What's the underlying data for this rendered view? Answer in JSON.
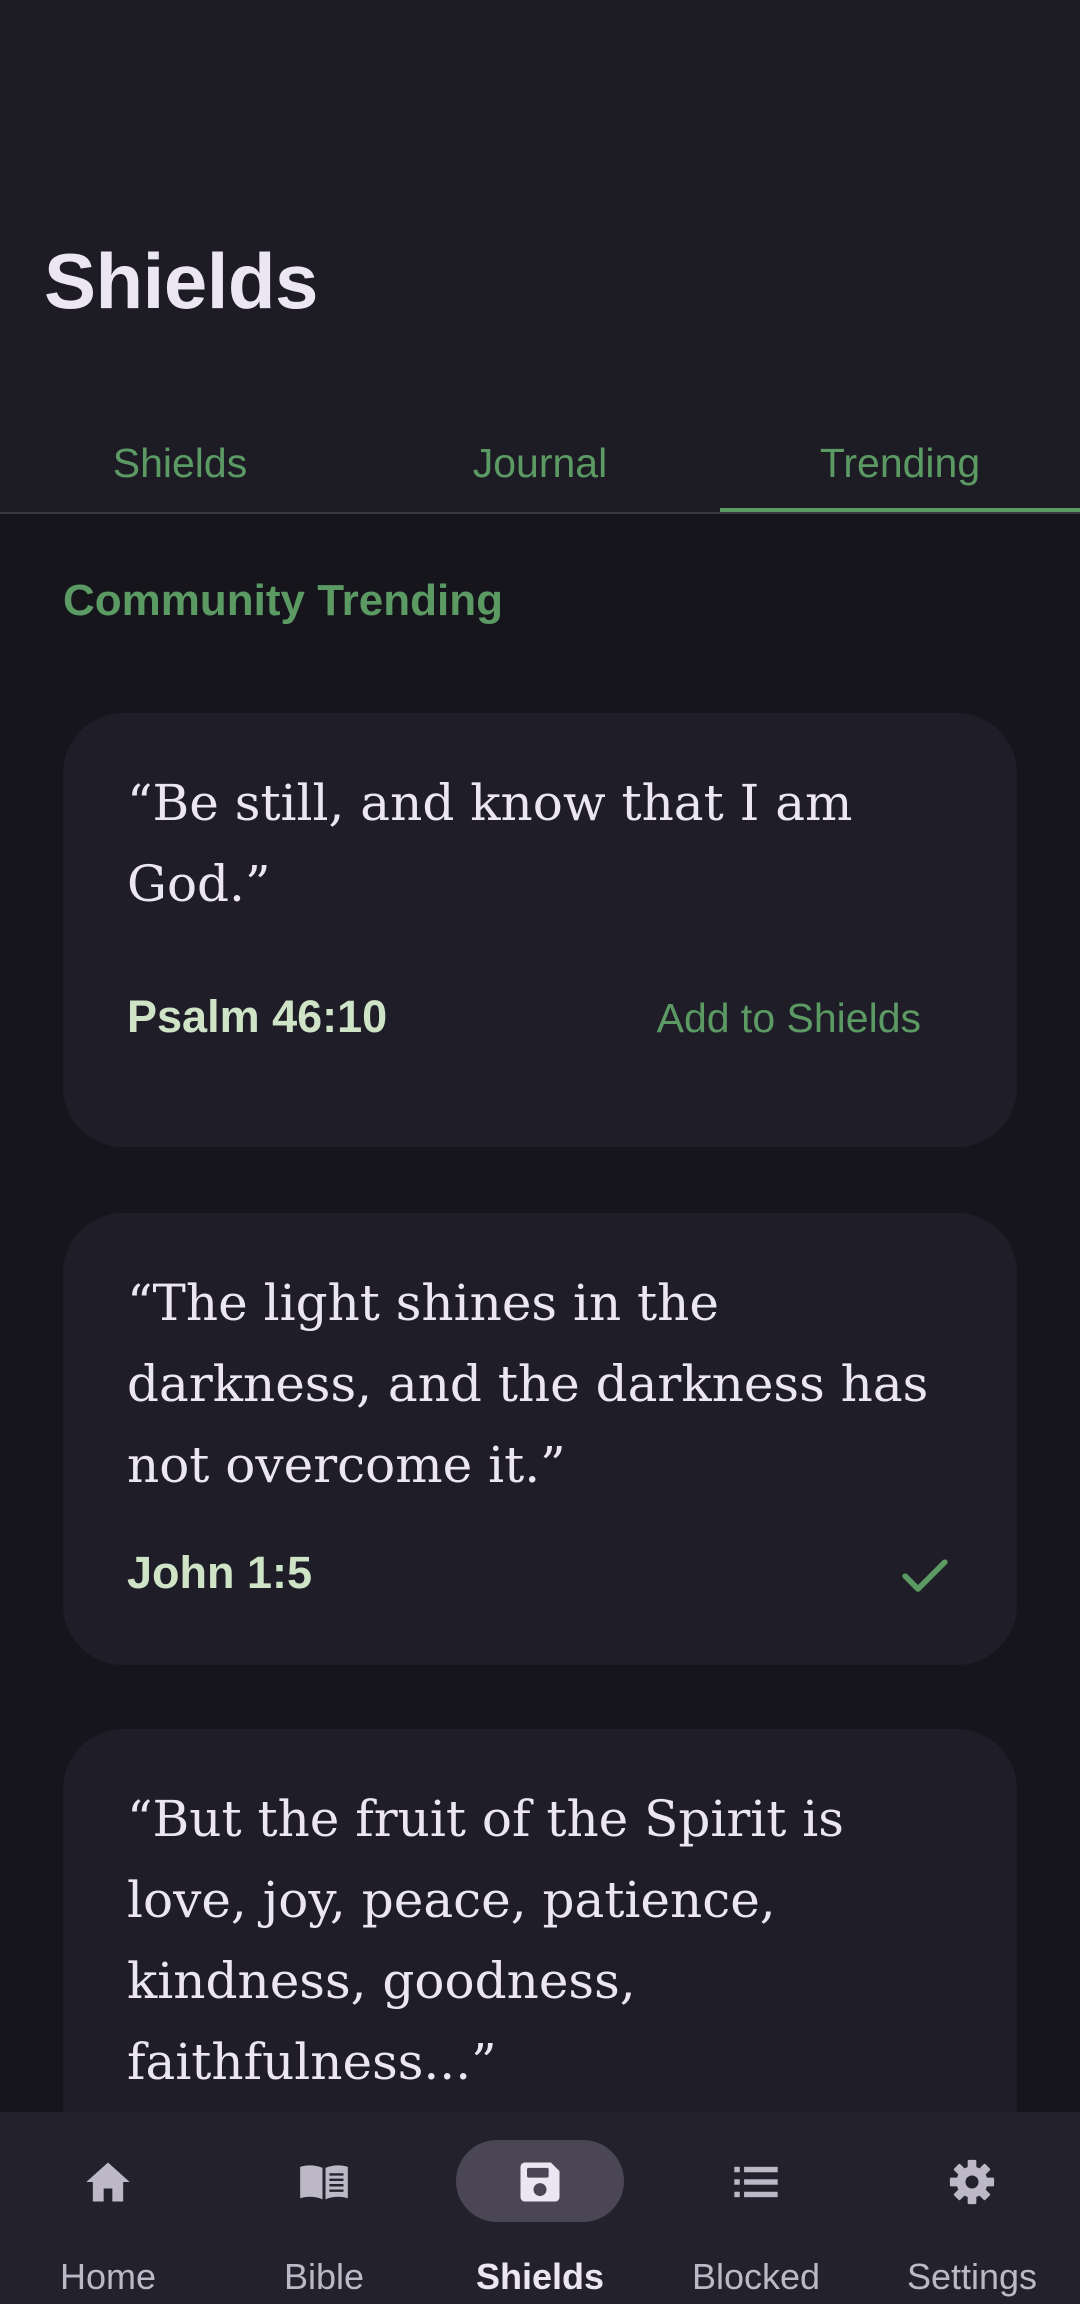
{
  "header": {
    "title": "Shields"
  },
  "tabs": [
    {
      "label": "Shields",
      "active": false
    },
    {
      "label": "Journal",
      "active": false
    },
    {
      "label": "Trending",
      "active": true
    }
  ],
  "section": {
    "heading": "Community Trending"
  },
  "cards": [
    {
      "verse": "“Be still, and know that I am God.”",
      "reference": "Psalm 46:10",
      "action_label": "Add to Shields",
      "added": false
    },
    {
      "verse": "“The light shines in the darkness, and the darkness has not overcome it.”",
      "reference": "John 1:5",
      "added": true,
      "action_icon": "check-icon"
    },
    {
      "verse": "“But the fruit of the Spirit is love, joy, peace, patience, kindness, goodness, faithfulness...”"
    }
  ],
  "bottom_nav": [
    {
      "label": "Home",
      "icon": "home-icon",
      "active": false
    },
    {
      "label": "Bible",
      "icon": "book-icon",
      "active": false
    },
    {
      "label": "Shields",
      "icon": "save-icon",
      "active": true
    },
    {
      "label": "Blocked",
      "icon": "list-icon",
      "active": false
    },
    {
      "label": "Settings",
      "icon": "gear-icon",
      "active": false
    }
  ],
  "colors": {
    "accent": "#5c9a64",
    "reference": "#cfe4c6",
    "background": "#16151c",
    "card": "#1f1e28",
    "nav_active_pill": "#4a4656"
  }
}
